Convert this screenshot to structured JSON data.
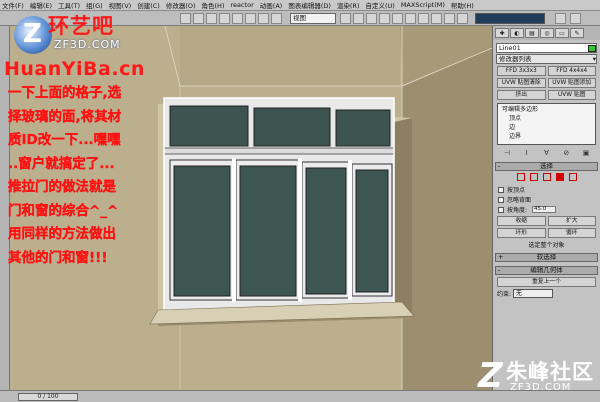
{
  "menu": {
    "items": [
      "文件(F)",
      "编辑(E)",
      "工具(T)",
      "组(G)",
      "视图(V)",
      "创建(C)",
      "修改器(O)",
      "角色(H)",
      "reactor",
      "动画(A)",
      "图表编辑器(D)",
      "渲染(R)",
      "自定义(U)",
      "MAXScript(M)",
      "帮助(H)"
    ]
  },
  "toolbar": {
    "view_select": "视图",
    "named_set_select": ""
  },
  "overlay": {
    "logo_cn": "环艺吧",
    "logo_site": "ZF3D.COM",
    "huanyiba_url": "HuanYiBa.cn",
    "instructions": [
      "一下上面的格子,选",
      "择玻璃的面,将其材",
      "质ID改一下...嘿嘿",
      "..窗户就搞定了...",
      "推拉门的做法就是",
      "门和窗的综合^_^",
      "用同样的方法做出",
      "其他的门和窗!!!"
    ],
    "watermark_cn": "朱峰社区",
    "watermark_url": "ZF3D.COM"
  },
  "command_panel": {
    "object_name": "Line01",
    "modifier_list": "修改器列表",
    "buttons_row1": [
      "FFD 3x3x3",
      "FFD 4x4x4"
    ],
    "buttons_row2": [
      "UVW 贴图清除",
      "UVW 贴图添加"
    ],
    "buttons_row3": [
      "挤出",
      "UVW 贴图"
    ],
    "stack": [
      {
        "label": "可编辑多边形",
        "selected": false,
        "sub": false
      },
      {
        "label": "顶点",
        "selected": false,
        "sub": true
      },
      {
        "label": "边",
        "selected": false,
        "sub": true
      },
      {
        "label": "边界",
        "selected": false,
        "sub": true
      },
      {
        "label": "多边形",
        "selected": true,
        "sub": true
      }
    ],
    "selection_rollout": "选择",
    "chk_by_vertex": "按顶点",
    "chk_ignore_backface": "忽略背面",
    "chk_by_angle": "按角度:",
    "angle_value": "45.0",
    "shrink_label": "收缩",
    "grow_label": "扩大",
    "ring_label": "环形",
    "loop_label": "循环",
    "selection_status": "选定整个对象",
    "soft_selection": "软选择",
    "edit_geometry": "编辑几何体",
    "repeat_last": "重复上一个",
    "constraint_label": "约束:",
    "constraint_value": "无"
  },
  "status": {
    "frame": "0 / 100"
  }
}
